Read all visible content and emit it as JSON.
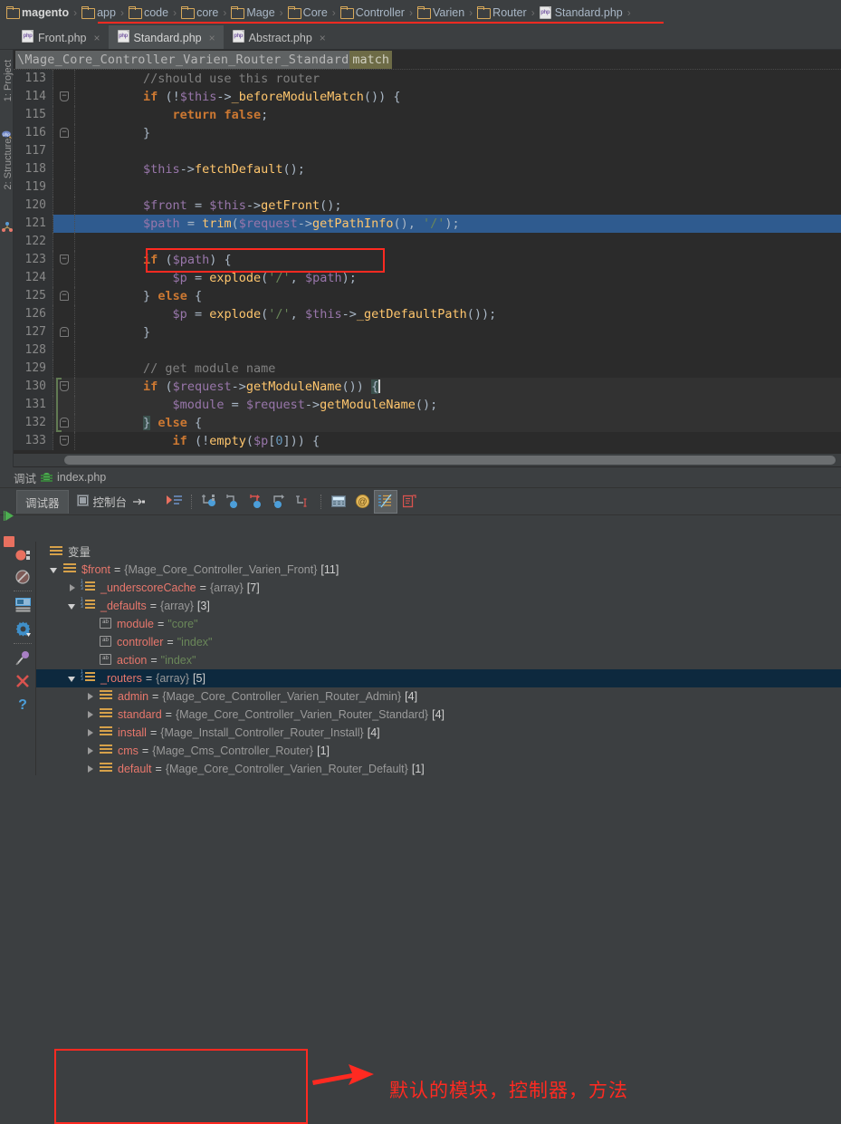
{
  "breadcrumb": {
    "items": [
      {
        "label": "magento",
        "icon": "folder-icon"
      },
      {
        "label": "app",
        "icon": "folder-icon"
      },
      {
        "label": "code",
        "icon": "folder-icon"
      },
      {
        "label": "core",
        "icon": "folder-icon"
      },
      {
        "label": "Mage",
        "icon": "folder-icon"
      },
      {
        "label": "Core",
        "icon": "folder-icon"
      },
      {
        "label": "Controller",
        "icon": "folder-icon"
      },
      {
        "label": "Varien",
        "icon": "folder-icon"
      },
      {
        "label": "Router",
        "icon": "folder-icon"
      },
      {
        "label": "Standard.php",
        "icon": "php-file-icon"
      }
    ],
    "separator": "›",
    "underline_color": "#ff2a21"
  },
  "editor_tabs": [
    {
      "label": "Front.php",
      "icon": "php-file-icon",
      "close": "×",
      "active": false
    },
    {
      "label": "Standard.php",
      "icon": "php-file-icon",
      "close": "×",
      "active": true
    },
    {
      "label": "Abstract.php",
      "icon": "php-file-icon",
      "close": "×",
      "active": false
    }
  ],
  "left_strip": {
    "project_tab": "1: Project",
    "structure_tab": "2: Structure"
  },
  "editor": {
    "context_path": "\\Mage_Core_Controller_Varien_Router_Standard",
    "context_member": "match",
    "first_line": 113,
    "selected_line": 121,
    "highlight_box_line": 120,
    "lines": [
      {
        "n": 113,
        "fold": "",
        "html": "<span class='cm'>        //should use this router</span>"
      },
      {
        "n": 114,
        "fold": "minus",
        "html": "        <span class='kw'>if</span> <span class='pn'>(!</span><span class='var'>$this</span><span class='pn'>-&gt;</span><span class='fn'>_beforeModuleMatch</span><span class='pn'>()) {</span>"
      },
      {
        "n": 115,
        "fold": "",
        "html": "            <span class='kw'>return</span> <span class='kw'>false</span><span class='pn'>;</span>"
      },
      {
        "n": 116,
        "fold": "end",
        "html": "        <span class='pn'>}</span>"
      },
      {
        "n": 117,
        "fold": "",
        "html": ""
      },
      {
        "n": 118,
        "fold": "",
        "html": "        <span class='var'>$this</span><span class='pn'>-&gt;</span><span class='fn'>fetchDefault</span><span class='pn'>();</span>"
      },
      {
        "n": 119,
        "fold": "",
        "html": ""
      },
      {
        "n": 120,
        "fold": "",
        "html": "        <span class='var'>$front</span> <span class='pn'>=</span> <span class='var'>$this</span><span class='pn'>-&gt;</span><span class='fn'>getFront</span><span class='pn'>();</span>"
      },
      {
        "n": 121,
        "fold": "",
        "html": "        <span class='var'>$path</span> <span class='pn'>=</span> <span class='fn'>trim</span><span class='pn'>(</span><span class='var'>$request</span><span class='pn'>-&gt;</span><span class='fn'>getPathInfo</span><span class='pn'>(),</span> <span class='str'>'/'</span><span class='pn'>);</span>"
      },
      {
        "n": 122,
        "fold": "",
        "html": ""
      },
      {
        "n": 123,
        "fold": "minus",
        "html": "        <span class='kw'>if</span> <span class='pn'>(</span><span class='var'>$path</span><span class='pn'>) {</span>"
      },
      {
        "n": 124,
        "fold": "",
        "html": "            <span class='var'>$p</span> <span class='pn'>=</span> <span class='fn'>explode</span><span class='pn'>(</span><span class='str'>'/'</span><span class='pn'>,</span> <span class='var'>$path</span><span class='pn'>);</span>"
      },
      {
        "n": 125,
        "fold": "end",
        "html": "        <span class='pn'>}</span> <span class='kw'>else</span> <span class='pn'>{</span>"
      },
      {
        "n": 126,
        "fold": "",
        "html": "            <span class='var'>$p</span> <span class='pn'>=</span> <span class='fn'>explode</span><span class='pn'>(</span><span class='str'>'/'</span><span class='pn'>,</span> <span class='var'>$this</span><span class='pn'>-&gt;</span><span class='fn'>_getDefaultPath</span><span class='pn'>());</span>"
      },
      {
        "n": 127,
        "fold": "end",
        "html": "        <span class='pn'>}</span>"
      },
      {
        "n": 128,
        "fold": "",
        "html": ""
      },
      {
        "n": 129,
        "fold": "",
        "html": "        <span class='cm'>// get module name</span>"
      },
      {
        "n": 130,
        "fold": "minus",
        "html": "        <span class='kw'>if</span> <span class='pn'>(</span><span class='var'>$request</span><span class='pn'>-&gt;</span><span class='fn'>getModuleName</span><span class='pn'>())</span> <span class='brhl pn'>{</span><span class='cursorbar'></span>"
      },
      {
        "n": 131,
        "fold": "",
        "html": "            <span class='var'>$module</span> <span class='pn'>=</span> <span class='var'>$request</span><span class='pn'>-&gt;</span><span class='fn'>getModuleName</span><span class='pn'>();</span>"
      },
      {
        "n": 132,
        "fold": "end",
        "html": "        <span class='brhl pn'>}</span> <span class='kw'>else</span> <span class='pn'>{</span>"
      },
      {
        "n": 133,
        "fold": "minus",
        "html": "            <span class='kw'>if</span> <span class='pn'>(!</span><span class='fn'>empty</span><span class='pn'>(</span><span class='var'>$p</span><span class='pn'>[</span><span class='num'>0</span><span class='pn'>])) {</span>"
      }
    ]
  },
  "debug": {
    "header_label": "调试",
    "header_icon": "bug-icon",
    "header_file": "index.php",
    "toolbar": {
      "resume_icon": "resume-program-icon",
      "stop_icon": "stop-program-icon",
      "tabs": [
        {
          "label": "调试器",
          "icon": "debugger-icon",
          "active": true
        },
        {
          "label": "控制台",
          "icon": "console-icon",
          "active": false
        }
      ],
      "tab_overflow_icon": "pin-tab-icon",
      "buttons": [
        {
          "icon": "rerun-icon",
          "name": "show-execution-point"
        },
        {
          "icon": "step-over-icon",
          "name": "step-over"
        },
        {
          "icon": "step-into-icon",
          "name": "step-into"
        },
        {
          "icon": "force-step-into-icon",
          "name": "force-step-into"
        },
        {
          "icon": "step-out-icon",
          "name": "step-out"
        },
        {
          "icon": "run-to-cursor-icon",
          "name": "run-to-cursor"
        },
        {
          "icon": "evaluate-expression-icon",
          "name": "evaluate-expression"
        },
        {
          "icon": "watch-icon",
          "name": "add-watch"
        },
        {
          "icon": "variables-view-icon",
          "name": "variables-view"
        },
        {
          "icon": "export-threads-icon",
          "name": "export-threads"
        }
      ]
    },
    "rail_icons": [
      "breakpoint-icon",
      "mute-breakpoints-icon",
      "restore-layout-icon",
      "settings-gear-icon",
      "pin-icon",
      "close-icon",
      "help-icon"
    ],
    "variables_label": "变量",
    "variables_icon": "variables-list-icon",
    "tree": [
      {
        "indent": 0,
        "twisty": "open",
        "icon": "object-icon",
        "name": "$front",
        "eq": "=",
        "type": "{Mage_Core_Controller_Varien_Front}",
        "count": "[11]",
        "value": null,
        "selected": false
      },
      {
        "indent": 1,
        "twisty": "closed",
        "icon": "array-icon",
        "name": "_underscoreCache",
        "eq": "=",
        "type": "{array}",
        "count": "[7]",
        "value": null,
        "selected": false
      },
      {
        "indent": 1,
        "twisty": "open",
        "icon": "array-icon",
        "name": "_defaults",
        "eq": "=",
        "type": "{array}",
        "count": "[3]",
        "value": null,
        "selected": false
      },
      {
        "indent": 2,
        "twisty": "none",
        "icon": "string-key-icon",
        "name": "module",
        "eq": "=",
        "type": null,
        "count": null,
        "value": "\"core\"",
        "selected": false
      },
      {
        "indent": 2,
        "twisty": "none",
        "icon": "string-key-icon",
        "name": "controller",
        "eq": "=",
        "type": null,
        "count": null,
        "value": "\"index\"",
        "selected": false
      },
      {
        "indent": 2,
        "twisty": "none",
        "icon": "string-key-icon",
        "name": "action",
        "eq": "=",
        "type": null,
        "count": null,
        "value": "\"index\"",
        "selected": false
      },
      {
        "indent": 1,
        "twisty": "open",
        "icon": "array-icon",
        "name": "_routers",
        "eq": "=",
        "type": "{array}",
        "count": "[5]",
        "value": null,
        "selected": true
      },
      {
        "indent": 2,
        "twisty": "closed",
        "icon": "object-icon",
        "name": "admin",
        "eq": "=",
        "type": "{Mage_Core_Controller_Varien_Router_Admin}",
        "count": "[4]",
        "value": null,
        "selected": false
      },
      {
        "indent": 2,
        "twisty": "closed",
        "icon": "object-icon",
        "name": "standard",
        "eq": "=",
        "type": "{Mage_Core_Controller_Varien_Router_Standard}",
        "count": "[4]",
        "value": null,
        "selected": false
      },
      {
        "indent": 2,
        "twisty": "closed",
        "icon": "object-icon",
        "name": "install",
        "eq": "=",
        "type": "{Mage_Install_Controller_Router_Install}",
        "count": "[4]",
        "value": null,
        "selected": false
      },
      {
        "indent": 2,
        "twisty": "closed",
        "icon": "object-icon",
        "name": "cms",
        "eq": "=",
        "type": "{Mage_Cms_Controller_Router}",
        "count": "[1]",
        "value": null,
        "selected": false
      },
      {
        "indent": 2,
        "twisty": "closed",
        "icon": "object-icon",
        "name": "default",
        "eq": "=",
        "type": "{Mage_Core_Controller_Varien_Router_Default}",
        "count": "[1]",
        "value": null,
        "selected": false
      }
    ]
  },
  "annotations": {
    "note_text": "默认的模块，控制器，方法",
    "note_color": "#ff2a21",
    "arrow_icon": "red-arrow-icon"
  }
}
